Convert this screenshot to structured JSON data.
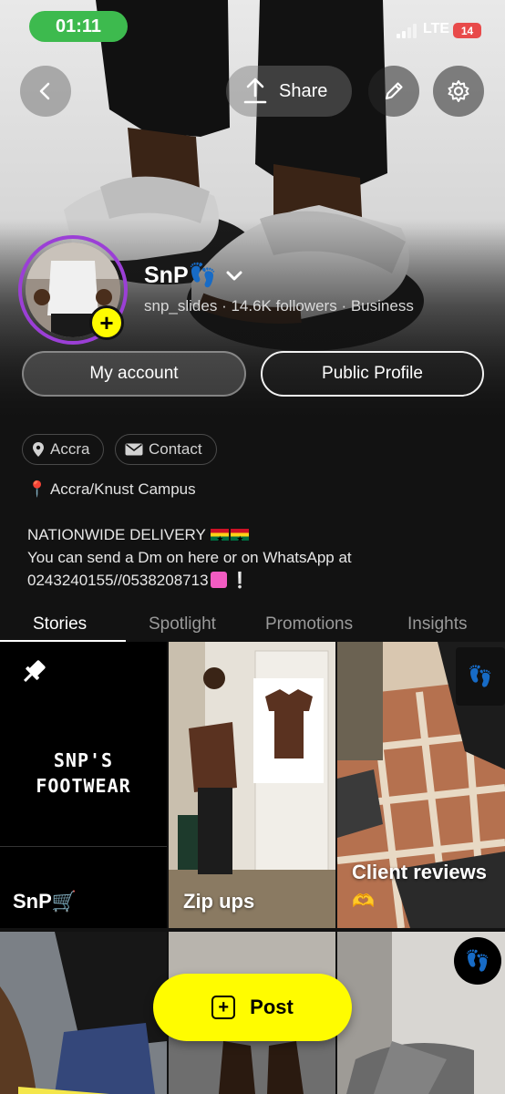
{
  "status_bar": {
    "time": "01:11",
    "network": "LTE",
    "battery": "14"
  },
  "hero_actions": {
    "back_icon": "chevron-left-icon",
    "share_label": "Share",
    "share_icon": "share-upload-icon",
    "edit_icon": "pencil-icon",
    "settings_icon": "gear-icon"
  },
  "profile": {
    "name": "SnP👣",
    "username": "snp_slides",
    "followers": "14.6K followers",
    "category": "Business",
    "meta_separator": "·"
  },
  "account_buttons": {
    "my_account": "My account",
    "public_profile": "Public Profile"
  },
  "chips": [
    {
      "label": "Accra",
      "icon": "location-pin-icon"
    },
    {
      "label": "Contact",
      "icon": "mail-icon"
    }
  ],
  "location_line": "📍 Accra/Knust Campus",
  "bio": {
    "line1": "NATIONWIDE DELIVERY",
    "line2": "You can send a Dm on here or on WhatsApp at",
    "line3": "0243240155//0538208713",
    "line3_suffix": "❕"
  },
  "tabs": [
    {
      "label": "Stories",
      "active": true
    },
    {
      "label": "Spotlight",
      "active": false
    },
    {
      "label": "Promotions",
      "active": false
    },
    {
      "label": "Insights",
      "active": false
    }
  ],
  "stories": [
    {
      "title": "SnP🛒",
      "logo_text_1": "SNP'S",
      "logo_text_2": "FOOTWEAR",
      "pinned": true
    },
    {
      "title": "Zip ups"
    },
    {
      "title": "Client reviews",
      "emoji": "🫶"
    }
  ],
  "post_button": {
    "label": "Post"
  },
  "colors": {
    "snap_yellow": "#fffc00",
    "status_green": "#3dba4e",
    "avatar_ring": "#9b3fd6",
    "battery_red": "#e84a4a"
  }
}
